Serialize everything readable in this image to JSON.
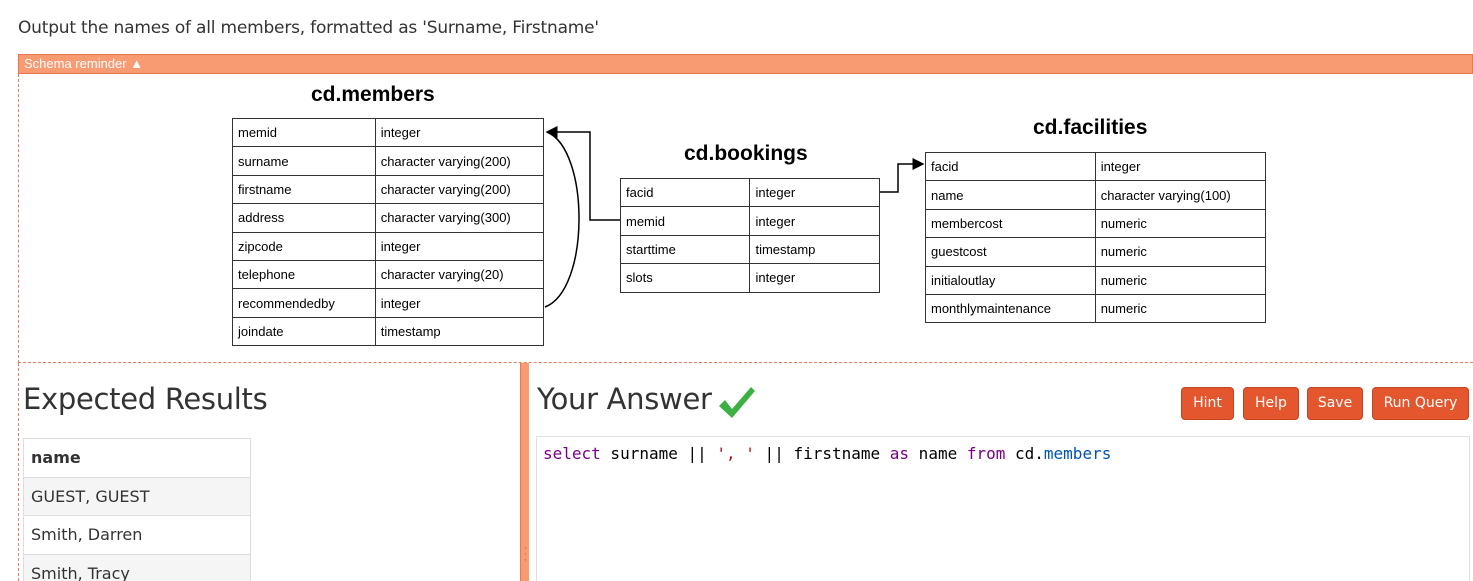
{
  "question": "Output the names of all members, formatted as 'Surname, Firstname'",
  "schema_toggle": "Schema reminder ▲",
  "schema": {
    "members": {
      "title": "cd.members",
      "rows": [
        [
          "memid",
          "integer"
        ],
        [
          "surname",
          "character varying(200)"
        ],
        [
          "firstname",
          "character varying(200)"
        ],
        [
          "address",
          "character varying(300)"
        ],
        [
          "zipcode",
          "integer"
        ],
        [
          "telephone",
          "character varying(20)"
        ],
        [
          "recommendedby",
          "integer"
        ],
        [
          "joindate",
          "timestamp"
        ]
      ]
    },
    "bookings": {
      "title": "cd.bookings",
      "rows": [
        [
          "facid",
          "integer"
        ],
        [
          "memid",
          "integer"
        ],
        [
          "starttime",
          "timestamp"
        ],
        [
          "slots",
          "integer"
        ]
      ]
    },
    "facilities": {
      "title": "cd.facilities",
      "rows": [
        [
          "facid",
          "integer"
        ],
        [
          "name",
          "character varying(100)"
        ],
        [
          "membercost",
          "numeric"
        ],
        [
          "guestcost",
          "numeric"
        ],
        [
          "initialoutlay",
          "numeric"
        ],
        [
          "monthlymaintenance",
          "numeric"
        ]
      ]
    }
  },
  "expected": {
    "heading": "Expected Results",
    "column": "name",
    "rows": [
      "GUEST, GUEST",
      "Smith, Darren",
      "Smith, Tracy"
    ]
  },
  "answer": {
    "heading": "Your Answer",
    "status_icon": "checkmark-icon",
    "buttons": {
      "hint": "Hint",
      "help": "Help",
      "save": "Save",
      "run": "Run Query"
    },
    "query": {
      "kw_select": "select",
      "t1": " surname || ",
      "s1": "', '",
      "t2": " || firstname ",
      "kw_as": "as",
      "t3": " name ",
      "kw_from": "from",
      "t4": " cd.",
      "table": "members"
    }
  },
  "colors": {
    "accent": "#e4572e",
    "schema_bar": "#f89a72",
    "check": "#3cb043"
  }
}
